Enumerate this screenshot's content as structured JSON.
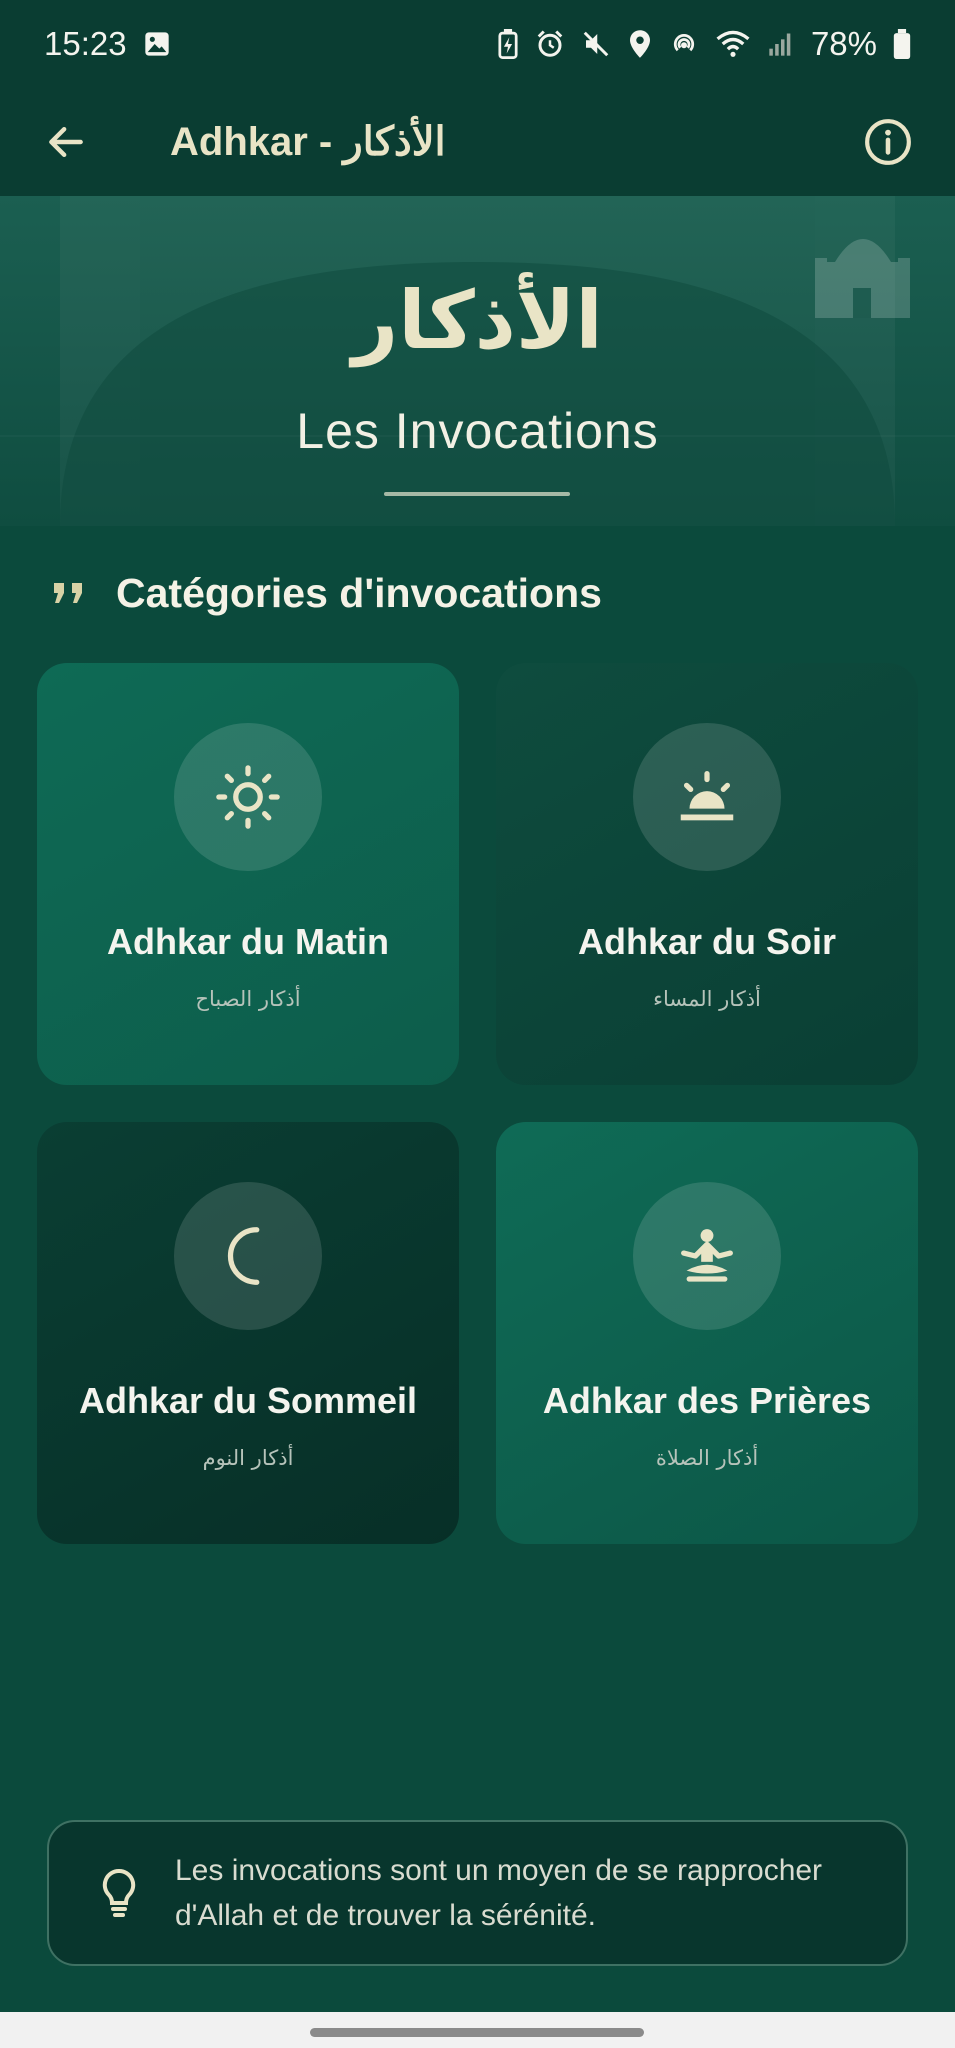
{
  "status_bar": {
    "time": "15:23",
    "battery": "78%",
    "icons": [
      "image-icon",
      "battery-saver-icon",
      "alarm-icon",
      "mute-icon",
      "location-icon",
      "hotspot-icon",
      "wifi-icon",
      "signal-icon",
      "battery-icon"
    ]
  },
  "app_bar": {
    "title": "Adhkar - الأذكار",
    "back_icon": "arrow-left-icon",
    "info_icon": "info-icon"
  },
  "hero": {
    "arabic_title": "الأذكار",
    "subtitle": "Les Invocations"
  },
  "section": {
    "icon": "quote-icon",
    "title": "Catégories d'invocations"
  },
  "categories": [
    {
      "title": "Adhkar du Matin",
      "arabic": "أذكار الصباح",
      "icon": "sun-icon"
    },
    {
      "title": "Adhkar du Soir",
      "arabic": "أذكار المساء",
      "icon": "sunset-icon"
    },
    {
      "title": "Adhkar du Sommeil",
      "arabic": "أذكار النوم",
      "icon": "moon-icon"
    },
    {
      "title": "Adhkar des Prières",
      "arabic": "أذكار الصلاة",
      "icon": "prayer-icon"
    }
  ],
  "tip": {
    "icon": "lightbulb-icon",
    "text": "Les invocations sont un moyen de se rapprocher d'Allah et de trouver la sérénité."
  },
  "colors": {
    "background": "#0b4a3c",
    "app_bar": "#0a3d32",
    "accent_text": "#e9e4c6"
  }
}
